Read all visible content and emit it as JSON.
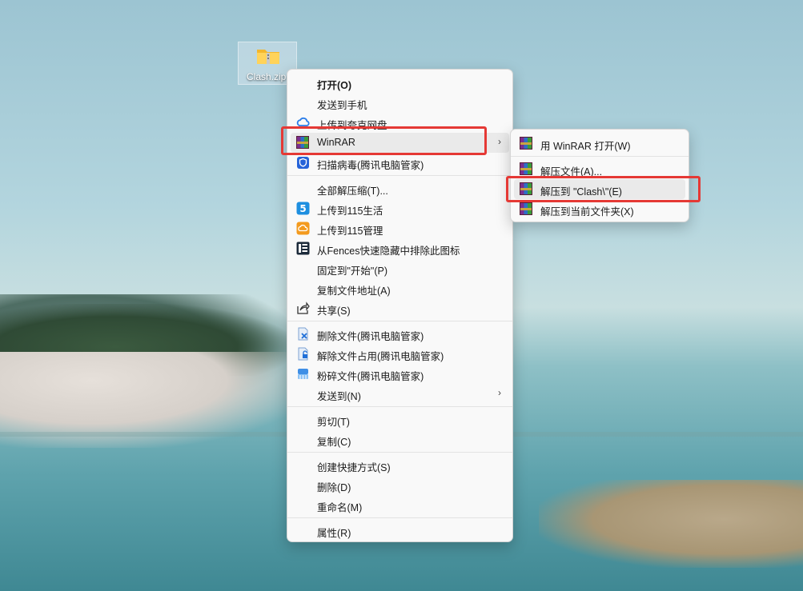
{
  "desktop": {
    "file_label": "Clash.zip"
  },
  "menu": {
    "items": [
      {
        "label": "打开(O)"
      },
      {
        "label": "发送到手机"
      },
      {
        "label": "上传到夸克网盘"
      },
      {
        "label": "WinRAR"
      },
      {
        "label": "扫描病毒(腾讯电脑管家)"
      },
      {
        "label": "全部解压缩(T)..."
      },
      {
        "label": "上传到115生活"
      },
      {
        "label": "上传到115管理"
      },
      {
        "label": "从Fences快速隐藏中排除此图标"
      },
      {
        "label": "固定到\"开始\"(P)"
      },
      {
        "label": "复制文件地址(A)"
      },
      {
        "label": "共享(S)"
      },
      {
        "label": "删除文件(腾讯电脑管家)"
      },
      {
        "label": "解除文件占用(腾讯电脑管家)"
      },
      {
        "label": "粉碎文件(腾讯电脑管家)"
      },
      {
        "label": "发送到(N)"
      },
      {
        "label": "剪切(T)"
      },
      {
        "label": "复制(C)"
      },
      {
        "label": "创建快捷方式(S)"
      },
      {
        "label": "删除(D)"
      },
      {
        "label": "重命名(M)"
      },
      {
        "label": "属性(R)"
      }
    ]
  },
  "submenu": {
    "items": [
      {
        "label": "用 WinRAR 打开(W)"
      },
      {
        "label": "解压文件(A)..."
      },
      {
        "label": "解压到 \"Clash\\\"(E)"
      },
      {
        "label": "解压到当前文件夹(X)"
      }
    ]
  },
  "colors": {
    "highlight_box": "#e53935",
    "menu_background": "#f9f9f9",
    "hover": "#eaeaea"
  }
}
